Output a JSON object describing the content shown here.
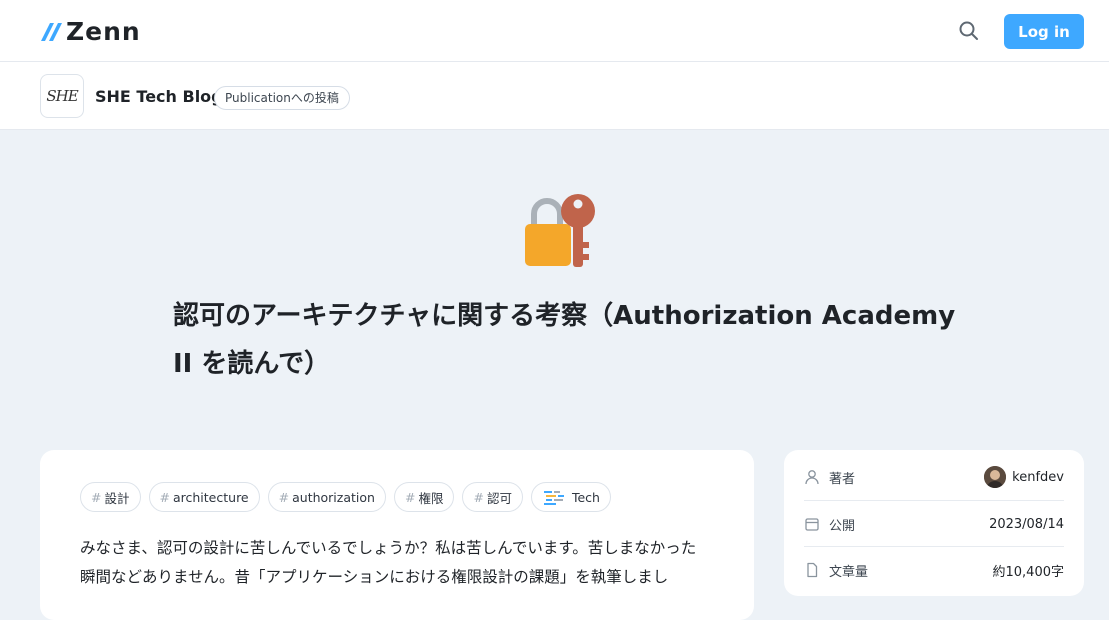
{
  "header": {
    "logo_text": "Zenn",
    "search_icon": "search-icon",
    "login_label": "Log in",
    "accent_color": "#3ea8ff"
  },
  "publication": {
    "avatar_text": "SHE",
    "name": "SHE Tech Blog",
    "badge": "Publicationへの投稿"
  },
  "article": {
    "emoji_icon": "lock-with-key-icon",
    "title": "認可のアーキテクチャに関する考察（Authorization Academy II を読んで）",
    "tags": [
      {
        "label": "設計",
        "type": "topic"
      },
      {
        "label": "architecture",
        "type": "topic"
      },
      {
        "label": "authorization",
        "type": "topic"
      },
      {
        "label": "権限",
        "type": "topic"
      },
      {
        "label": "認可",
        "type": "topic"
      },
      {
        "label": "Tech",
        "type": "category",
        "icon": "tech-code-icon"
      }
    ],
    "body_text": "みなさま、認可の設計に苦しんでいるでしょうか？私は苦しんでいます。苦しまなかった瞬間などありません。昔「アプリケーションにおける権限設計の課題」を執筆しまし"
  },
  "sidebar": {
    "author_label": "著者",
    "author_name": "kenfdev",
    "published_label": "公開",
    "published_date": "2023/08/14",
    "length_label": "文章量",
    "length_value": "約10,400字"
  }
}
